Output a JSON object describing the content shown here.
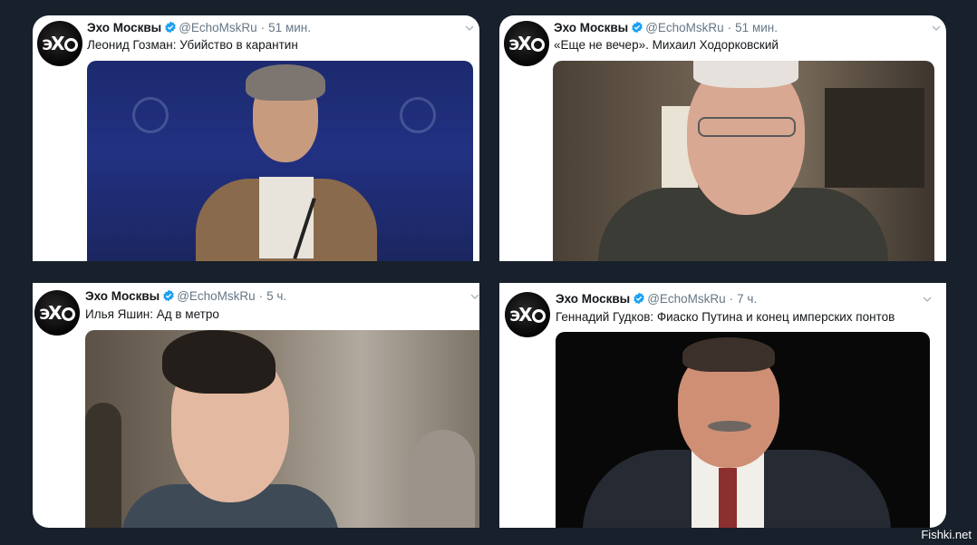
{
  "tweets": [
    {
      "author": "Эхо Москвы",
      "handle": "@EchoMskRu",
      "separator": "·",
      "time": "51 мин.",
      "text": "Леонид Гозман: Убийство в карантин"
    },
    {
      "author": "Эхо Москвы",
      "handle": "@EchoMskRu",
      "separator": "·",
      "time": "51 мин.",
      "text": "«Еще не вечер». Михаил Ходорковский"
    },
    {
      "author": "Эхо Москвы",
      "handle": "@EchoMskRu",
      "separator": "·",
      "time": "5 ч.",
      "text": "Илья Яшин: Ад в метро"
    },
    {
      "author": "Эхо Москвы",
      "handle": "@EchoMskRu",
      "separator": "·",
      "time": "7 ч.",
      "text": "Геннадий Гудков: Фиаско Путина и конец имперских понтов"
    }
  ],
  "avatar_logo": {
    "part1": "Э",
    "part2": "Х"
  },
  "watermark": "Fishki.net",
  "colors": {
    "background": "#17202b",
    "card": "#ffffff",
    "verified": "#1da1f2",
    "secondary_text": "#657786"
  }
}
